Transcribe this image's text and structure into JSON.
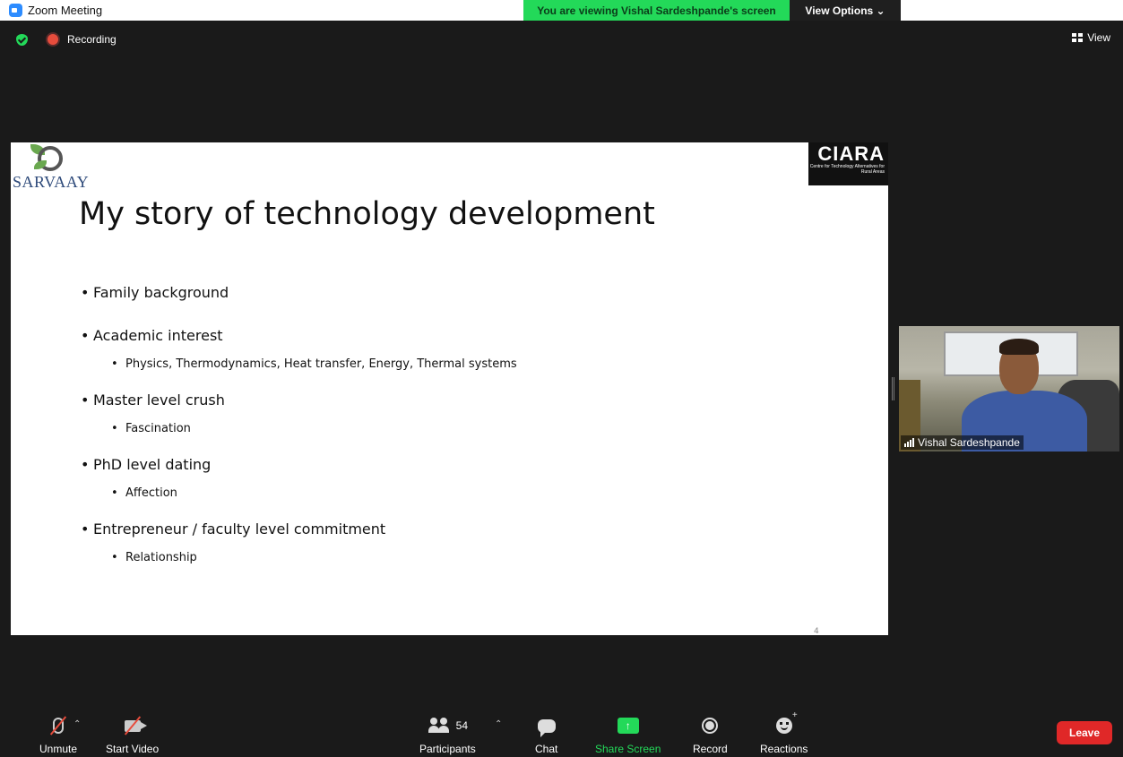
{
  "window": {
    "title": "Zoom Meeting"
  },
  "banner": {
    "viewing": "You are viewing Vishal Sardeshpande's screen",
    "view_options": "View Options ⌄"
  },
  "status": {
    "recording": "Recording",
    "view": "View"
  },
  "slide": {
    "logo_left": "SARVAAY",
    "logo_right": "CIARA",
    "logo_right_sub": "Centre for Technology Alternatives for Rural Areas",
    "title": "My story of technology development",
    "bullets": [
      {
        "text": "Family background"
      },
      {
        "text": "Academic interest",
        "sub": "Physics, Thermodynamics, Heat transfer, Energy, Thermal systems"
      },
      {
        "text": "Master level crush",
        "sub": "Fascination"
      },
      {
        "text": "PhD level dating",
        "sub": "Affection"
      },
      {
        "text": "Entrepreneur / faculty level commitment",
        "sub": "Relationship"
      }
    ],
    "page_number": "4"
  },
  "participant": {
    "name": "Vishal Sardeshpande"
  },
  "toolbar": {
    "unmute": "Unmute",
    "start_video": "Start Video",
    "participants": "Participants",
    "participants_count": "54",
    "chat": "Chat",
    "share_screen": "Share Screen",
    "record": "Record",
    "reactions": "Reactions",
    "leave": "Leave"
  },
  "colors": {
    "accent_green": "#23d959",
    "leave_red": "#e02828",
    "background": "#1a1a1a"
  },
  "icons": [
    "zoom-logo-icon",
    "shield-icon",
    "recording-icon",
    "grid-icon",
    "mic-muted-icon",
    "video-off-icon",
    "participants-icon",
    "chat-icon",
    "share-screen-icon",
    "record-icon",
    "reactions-icon",
    "signal-bars-icon"
  ]
}
